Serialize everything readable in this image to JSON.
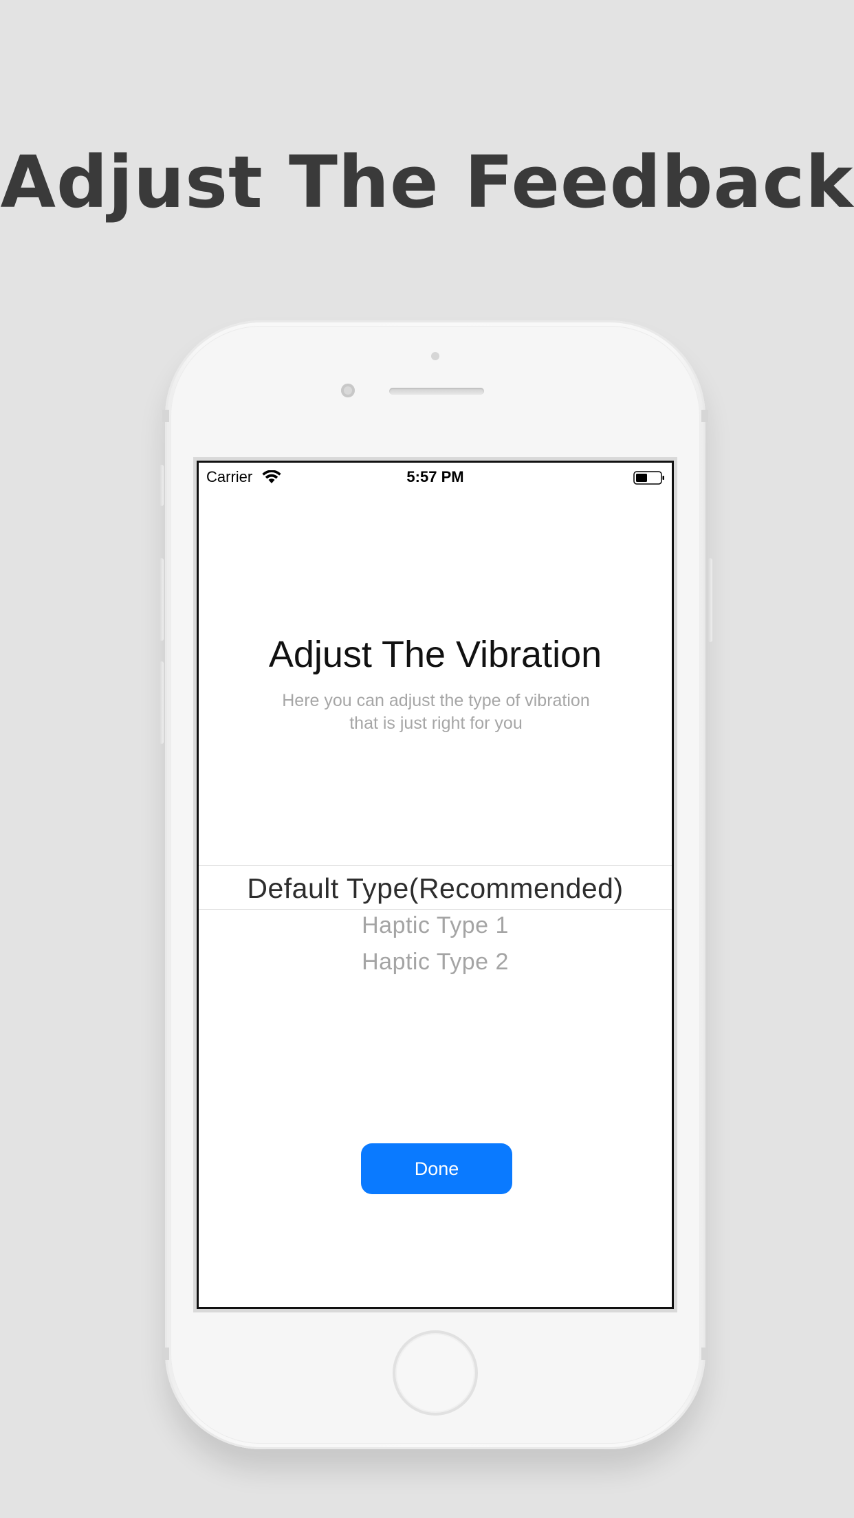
{
  "headline": "Adjust The Feedback",
  "status_bar": {
    "carrier": "Carrier",
    "time": "5:57 PM",
    "icons": [
      "wifi-icon",
      "battery-icon"
    ]
  },
  "screen": {
    "title": "Adjust The Vibration",
    "subtitle_lines": [
      "Here you can adjust the type of vibration",
      "that is just right for you"
    ]
  },
  "picker": {
    "selected": "Default Type(Recommended)",
    "options": [
      "Haptic Type 1",
      "Haptic Type 2"
    ]
  },
  "done_button": {
    "label": "Done",
    "color": "#0a7aff"
  },
  "colors": {
    "background": "#e3e3e3",
    "headline": "#3a3a3a",
    "subtitle": "#a6a6a6"
  }
}
